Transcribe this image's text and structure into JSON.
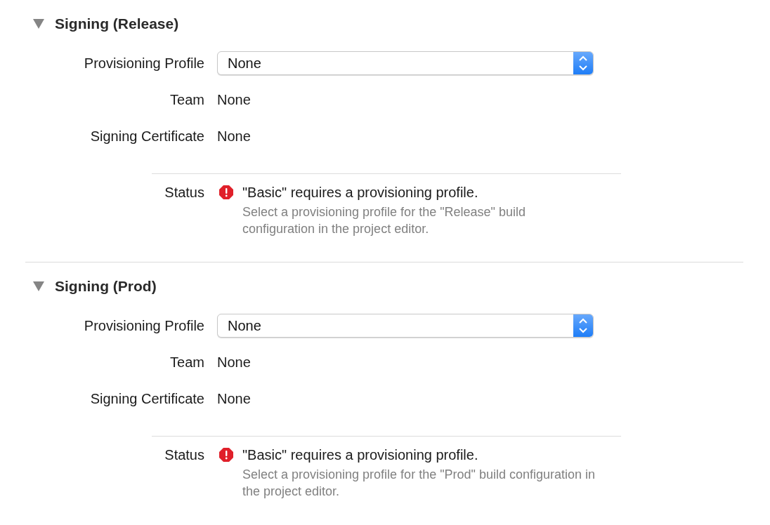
{
  "sections": [
    {
      "title": "Signing (Release)",
      "expanded": true,
      "rows": [
        {
          "kind": "popup",
          "label": "Provisioning Profile",
          "value": "None"
        },
        {
          "kind": "text",
          "label": "Team",
          "value": "None"
        },
        {
          "kind": "text",
          "label": "Signing Certificate",
          "value": "None"
        },
        {
          "kind": "status",
          "label": "Status",
          "message": "\"Basic\" requires a provisioning profile.",
          "detail": "Select a provisioning profile for the \"Release\" build configuration in the project editor."
        }
      ]
    },
    {
      "title": "Signing (Prod)",
      "expanded": true,
      "rows": [
        {
          "kind": "popup",
          "label": "Provisioning Profile",
          "value": "None"
        },
        {
          "kind": "text",
          "label": "Team",
          "value": "None"
        },
        {
          "kind": "text",
          "label": "Signing Certificate",
          "value": "None"
        },
        {
          "kind": "status",
          "label": "Status",
          "message": "\"Basic\" requires a provisioning profile.",
          "detail": "Select a provisioning profile for the \"Prod\" build configuration in the project editor."
        }
      ]
    }
  ]
}
